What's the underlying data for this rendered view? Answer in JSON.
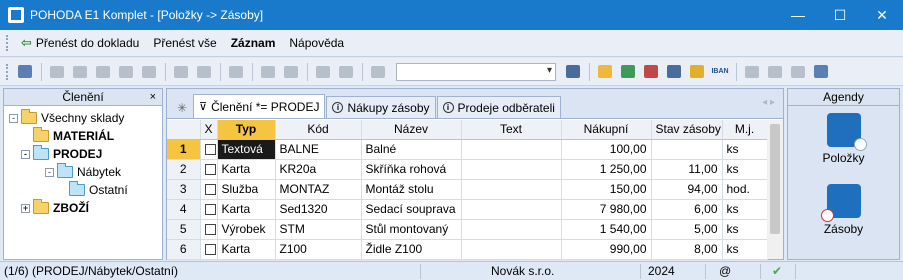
{
  "window": {
    "title": "POHODA E1 Komplet - [Položky -> Zásoby]",
    "minimize": "—",
    "maximize": "☐",
    "close": "✕"
  },
  "menu": [
    {
      "label": "Přenést do dokladu",
      "bold": false
    },
    {
      "label": "Přenést vše",
      "bold": false
    },
    {
      "label": "Záznam",
      "bold": true
    },
    {
      "label": "Nápověda",
      "bold": false
    }
  ],
  "toolbar": {
    "iban_label": "IBAN"
  },
  "left_panel": {
    "title": "Členění",
    "close": "×",
    "tree": [
      {
        "label": "Všechny sklady",
        "level": 0,
        "expander": "-",
        "bold": false
      },
      {
        "label": "MATERIÁL",
        "level": 1,
        "expander": "",
        "bold": true
      },
      {
        "label": "PRODEJ",
        "level": 1,
        "expander": "-",
        "bold": true
      },
      {
        "label": "Nábytek",
        "level": 2,
        "expander": "-",
        "bold": false
      },
      {
        "label": "Ostatní",
        "level": 3,
        "expander": "",
        "bold": false
      },
      {
        "label": "ZBOŽÍ",
        "level": 1,
        "expander": "+",
        "bold": true
      }
    ]
  },
  "tabs": [
    {
      "label": "Členění *= PRODEJ",
      "icon": "filter-icon",
      "active": true
    },
    {
      "label": "Nákupy zásoby",
      "icon": "info-icon",
      "active": false
    },
    {
      "label": "Prodeje odběrateli",
      "icon": "info-icon",
      "active": false
    }
  ],
  "table": {
    "columns": [
      "",
      "X",
      "Typ",
      "Kód",
      "Název",
      "Text",
      "Nákupní",
      "Stav zásoby",
      "M.j."
    ],
    "rows": [
      [
        "1",
        "",
        "Textová",
        "BALNE",
        "Balné",
        "",
        "100,00",
        "",
        "ks"
      ],
      [
        "2",
        "",
        "Karta",
        "KR20a",
        "Skříňka rohová",
        "",
        "1 250,00",
        "11,00",
        "ks"
      ],
      [
        "3",
        "",
        "Služba",
        "MONTAZ",
        "Montáž stolu",
        "",
        "150,00",
        "94,00",
        "hod."
      ],
      [
        "4",
        "",
        "Karta",
        "Sed1320",
        "Sedací souprava",
        "",
        "7 980,00",
        "6,00",
        "ks"
      ],
      [
        "5",
        "",
        "Výrobek",
        "STM",
        "Stůl montovaný",
        "",
        "1 540,00",
        "5,00",
        "ks"
      ],
      [
        "6",
        "",
        "Karta",
        "Z100",
        "Židle Z100",
        "",
        "990,00",
        "8,00",
        "ks"
      ]
    ]
  },
  "agendy": {
    "title": "Agendy",
    "items": [
      {
        "label": "Položky",
        "icon": "polozky-icon"
      },
      {
        "label": "Zásoby",
        "icon": "zasoby-icon"
      }
    ]
  },
  "status": {
    "path": "(1/6) (PRODEJ/Nábytek/Ostatní)",
    "company": "Novák s.r.o.",
    "year": "2024",
    "at": "@"
  },
  "colors": {
    "titlebar": "#1979ca",
    "highlight": "#f5c542",
    "agenda_icon": "#1f6fbf"
  }
}
